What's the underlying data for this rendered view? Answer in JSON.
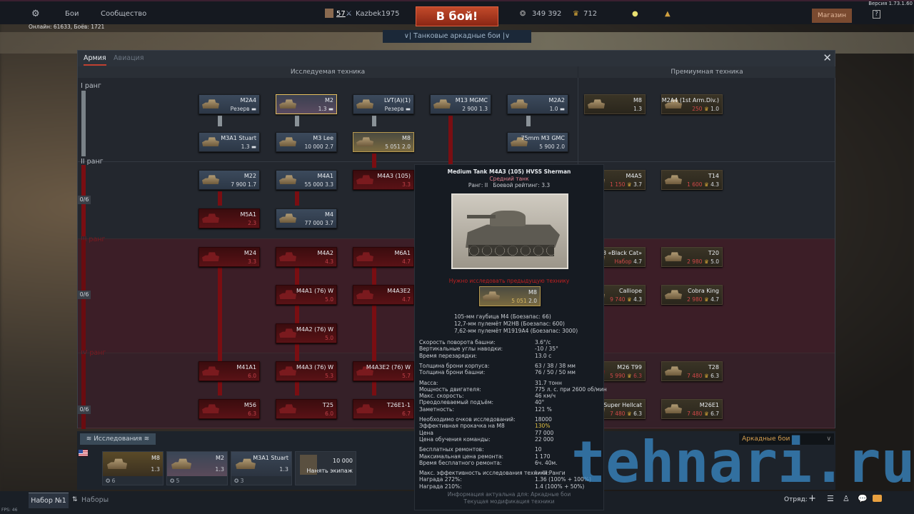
{
  "topbar": {
    "battles": "Бои",
    "community": "Сообщество",
    "online": "Онлайн: 61633, Боёв: 1721",
    "player_level": "57",
    "player_name": "Kazbek1975",
    "battle_button": "В бой!",
    "mode": "Танковые аркадные бои",
    "silver_lions": "349 392",
    "golden_eagles": "712",
    "shop": "Магазин",
    "help": "?",
    "version": "Версия 1.73.1.60"
  },
  "window": {
    "tabs": [
      "Армия",
      "Авиация"
    ],
    "research_header": "Исследуемая техника",
    "premium_header": "Премиумная техника",
    "ranks": [
      "I ранг",
      "II ранг",
      "III ранг",
      "IV ранг"
    ],
    "progress": [
      "0/6",
      "0/6",
      "0/6"
    ]
  },
  "vehicles": [
    {
      "name": "M2A4",
      "sub": "Резерв ▬",
      "state": "normal"
    },
    {
      "name": "M2",
      "sub": "1.3 ▬",
      "state": "sel"
    },
    {
      "name": "LVT(A)(1)",
      "sub": "Резерв ▬",
      "state": "normal"
    },
    {
      "name": "M13 MGMC",
      "sub": "2 900 1.3",
      "state": "normal"
    },
    {
      "name": "M2A2",
      "sub": "1.0 ▬",
      "state": "normal"
    },
    {
      "name": "M3A1 Stuart",
      "sub": "1.3 ▬",
      "state": "normal"
    },
    {
      "name": "M3 Lee",
      "sub": "10 000 2.7",
      "state": "normal"
    },
    {
      "name": "M8",
      "sub": "5 051 2.0",
      "state": "res"
    },
    {
      "name": "75mm M3 GMC",
      "sub": "5 900 2.0",
      "state": "normal"
    },
    {
      "name": "M22",
      "sub": "7 900 1.7",
      "state": "normal"
    },
    {
      "name": "M4A1",
      "sub": "55 000 3.3",
      "state": "normal"
    },
    {
      "name": "M4A3 (105)",
      "sub": "3.3",
      "state": "locked"
    },
    {
      "name": "M5A1",
      "sub": "2.3",
      "state": "locked"
    },
    {
      "name": "M4",
      "sub": "77 000 3.7",
      "state": "normal"
    },
    {
      "name": "M24",
      "sub": "3.3",
      "state": "locked"
    },
    {
      "name": "M4A2",
      "sub": "4.3",
      "state": "locked"
    },
    {
      "name": "M6A1",
      "sub": "4.7",
      "state": "locked"
    },
    {
      "name": "M4A1 (76) W",
      "sub": "5.0",
      "state": "locked"
    },
    {
      "name": "M4A3E2",
      "sub": "4.7",
      "state": "locked"
    },
    {
      "name": "M4A2 (76) W",
      "sub": "5.0",
      "state": "locked"
    },
    {
      "name": "M41A1",
      "sub": "6.0",
      "state": "locked"
    },
    {
      "name": "M4A3 (76) W",
      "sub": "5.3",
      "state": "locked"
    },
    {
      "name": "M4A3E2 (76) W",
      "sub": "5.7",
      "state": "locked"
    },
    {
      "name": "M56",
      "sub": "6.3",
      "state": "locked"
    },
    {
      "name": "T25",
      "sub": "6.0",
      "state": "locked"
    },
    {
      "name": "T26E1-1",
      "sub": "6.7",
      "state": "locked"
    }
  ],
  "premium": [
    {
      "name": "M8",
      "cost": "",
      "br": "1.3"
    },
    {
      "name": "M2A4 (1st Arm.Div.)",
      "cost": "250",
      "br": "1.0"
    },
    {
      "name": "M4A5",
      "cost": "1 150",
      "br": "3.7"
    },
    {
      "name": "T14",
      "cost": "1 600",
      "br": "4.3"
    },
    {
      "name": "M18 «Black Cat»",
      "cost": "Набор",
      "br": "4.7"
    },
    {
      "name": "T20",
      "cost": "2 980",
      "br": "5.0"
    },
    {
      "name": "Calliope",
      "cost": "9 740",
      "br": "4.3"
    },
    {
      "name": "Cobra King",
      "cost": "2 980",
      "br": "4.7"
    },
    {
      "name": "M26 T99",
      "cost": "5 990",
      "br": "6.3"
    },
    {
      "name": "T28",
      "cost": "7 480",
      "br": "6.3"
    },
    {
      "name": "Super Hellcat",
      "cost": "7 480",
      "br": "6.3"
    },
    {
      "name": "M26E1",
      "cost": "7 480",
      "br": "6.7"
    }
  ],
  "tooltip": {
    "title": "Medium Tank M4A3 (105) HVSS Sherman",
    "class": "Средний танк",
    "rank": "Ранг: II",
    "br": "Боевой рейтинг: 3.3",
    "warning": "Нужно исследовать предыдущую технику",
    "req_name": "M8",
    "req_cost": "5 051",
    "req_br": "2.0",
    "weapons": [
      "105-мм гаубица M4 (Боезапас: 66)",
      "12,7-мм пулемёт M2HB (Боезапас: 600)",
      "7,62-мм пулемёт M1919A4 (Боезапас: 3000)"
    ],
    "stats": [
      {
        "k": "Скорость поворота башни:",
        "v": "3.6°/с"
      },
      {
        "k": "Вертикальные углы наводки:",
        "v": "-10 / 35°"
      },
      {
        "k": "Время перезарядки:",
        "v": "13.0 с"
      },
      {
        "k": "Толщина брони корпуса:",
        "v": "63 / 38 / 38 мм"
      },
      {
        "k": "Толщина брони башни:",
        "v": "76 / 50 / 50 мм"
      },
      {
        "k": "Масса:",
        "v": "31.7 тонн"
      },
      {
        "k": "Мощность двигателя:",
        "v": "775 л. с. при 2600 об/мин"
      },
      {
        "k": "Макс. скорость:",
        "v": "46 км/ч"
      },
      {
        "k": "Преодолеваемый подъём:",
        "v": "40°"
      },
      {
        "k": "Заметность:",
        "v": "121 %"
      },
      {
        "k": "Необходимо очков исследований:",
        "v": "18000"
      },
      {
        "k": "Эффективная прокачка на M8",
        "v": "130%"
      },
      {
        "k": "Цена",
        "v": "77 000"
      },
      {
        "k": "Цена обучения команды:",
        "v": "22 000"
      },
      {
        "k": "Бесплатных ремонтов:",
        "v": "10"
      },
      {
        "k": "Максимальная цена ремонта:",
        "v": "1 170"
      },
      {
        "k": "Время бесплатного ремонта:",
        "v": "6ч. 40м."
      },
      {
        "k": "Макс. эффективность исследования техники:",
        "v": "I – III Ранги"
      },
      {
        "k": "Награда 272%:",
        "v": "1.36 (100% + 100%)"
      },
      {
        "k": "Награда 210%:",
        "v": "1.4 (100% + 50%)"
      }
    ],
    "footer1": "Информация актуальна для: Аркадные бои",
    "footer2": "Текущая модификация техники"
  },
  "bottom": {
    "research_tab": "Исследования",
    "mode_select": "Аркадные бои",
    "slots": [
      {
        "name": "M8",
        "br": "1.3",
        "crew": "6"
      },
      {
        "name": "M2",
        "br": "1.3",
        "crew": "5"
      },
      {
        "name": "M3A1 Stuart",
        "br": "1.3",
        "crew": "3"
      }
    ],
    "hire_cost": "10 000",
    "hire_label": "Нанять экипаж",
    "preset": "Набор №1",
    "presets": "Наборы",
    "squad": "Отряд:",
    "fps": "FPS: 46"
  },
  "watermark": "tehnari.ru"
}
